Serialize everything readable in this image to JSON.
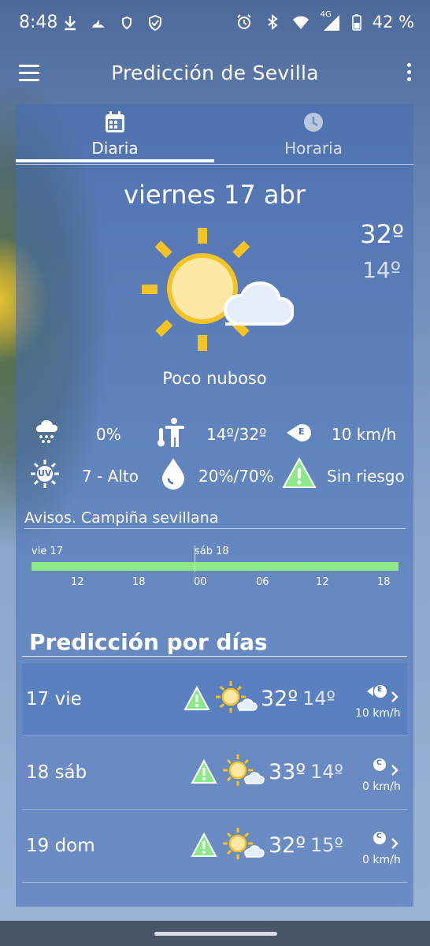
{
  "status_bar": {
    "time": "8:48",
    "network": "4G",
    "battery": "42 %"
  },
  "app_bar": {
    "title": "Predicción de Sevilla"
  },
  "tabs": [
    {
      "label": "Diaria",
      "icon": "calendar-icon",
      "active": true
    },
    {
      "label": "Horaria",
      "icon": "clock-icon",
      "active": false
    }
  ],
  "today": {
    "date": "viernes 17 abr",
    "temp_max": "32º",
    "temp_min": "14º",
    "description": "Poco nuboso",
    "icon": "sun-cloud-icon"
  },
  "stats": {
    "rain_prob": "0%",
    "thermal_sensation": "14º/32º",
    "wind_direction": "E",
    "wind_speed": "10 km/h",
    "uv": "7 - Alto",
    "uv_icon_label": "UV",
    "humidity": "20%/70%",
    "risk": "Sin riesgo"
  },
  "warnings": {
    "title": "Avisos. Campiña sevillana",
    "day_labels": [
      "vie 17",
      "sáb 18"
    ],
    "hours": [
      "12",
      "18",
      "00",
      "06",
      "12",
      "18"
    ],
    "level_color": "#8ee88a"
  },
  "forecast": {
    "title": "Predicción por días",
    "days": [
      {
        "name": "17 vie",
        "max": "32º",
        "min": "14º",
        "wind_dir": "E",
        "wind": "10 km/h",
        "selected": true
      },
      {
        "name": "18 sáb",
        "max": "33º",
        "min": "14º",
        "wind_dir": "C",
        "wind": "0 km/h",
        "selected": false
      },
      {
        "name": "19 dom",
        "max": "32º",
        "min": "15º",
        "wind_dir": "C",
        "wind": "0 km/h",
        "selected": false
      }
    ]
  },
  "colors": {
    "sun": "#f6c324",
    "sun_core": "#fde8a6",
    "warning_green": "#8ee88a",
    "card": "#466eb4"
  }
}
